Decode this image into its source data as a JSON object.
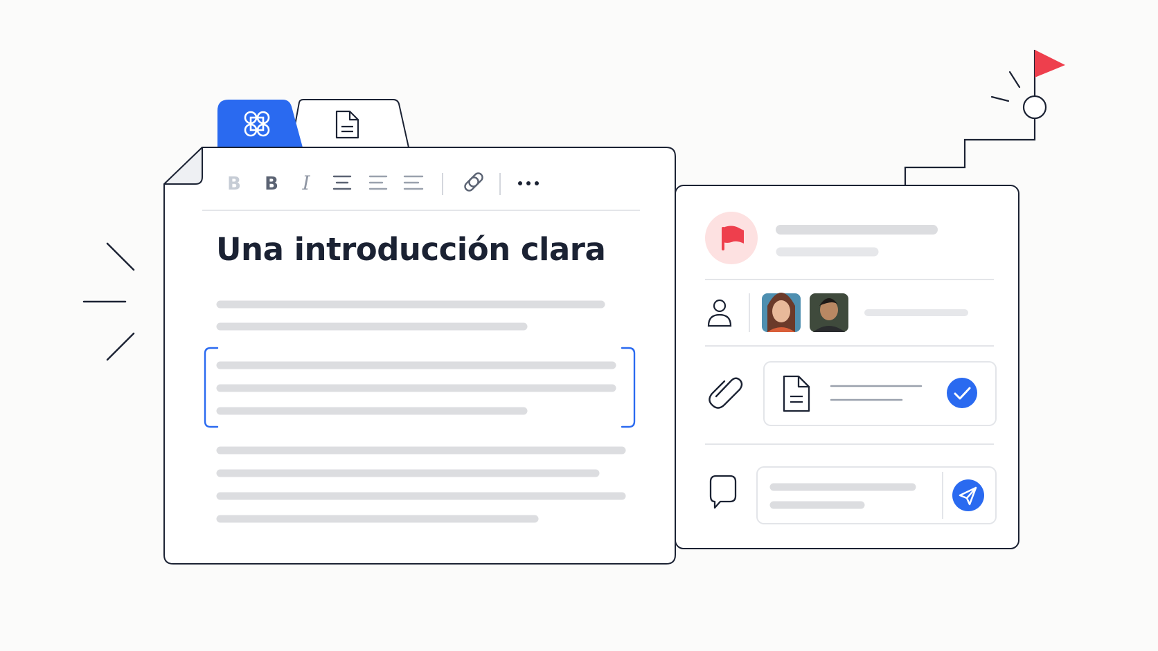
{
  "editor": {
    "title": "Una introducción clara",
    "tabs": [
      {
        "icon": "command-icon",
        "active": true
      },
      {
        "icon": "document-icon",
        "active": false
      }
    ],
    "toolbar": [
      {
        "icon": "bold-light-icon"
      },
      {
        "icon": "bold-icon"
      },
      {
        "icon": "italic-icon"
      },
      {
        "icon": "align-left-icon"
      },
      {
        "icon": "align-center-icon"
      },
      {
        "icon": "align-right-icon"
      },
      {
        "icon": "link-icon"
      },
      {
        "icon": "more-icon"
      }
    ]
  },
  "panel": {
    "rows": [
      {
        "icon": "flag-icon"
      },
      {
        "icon": "user-icon",
        "avatars": 2
      },
      {
        "icon": "paperclip-icon",
        "attachment": "document-icon",
        "status": "check-icon"
      },
      {
        "icon": "comment-icon",
        "action": "send-icon"
      }
    ]
  },
  "decor": {
    "goal": "flag-icon"
  },
  "colors": {
    "accent": "#2a6af0",
    "flag": "#ee3f4d",
    "flag_bg": "#fde1e1",
    "outline": "#1b2233",
    "placeholder": "#dcdde0"
  }
}
